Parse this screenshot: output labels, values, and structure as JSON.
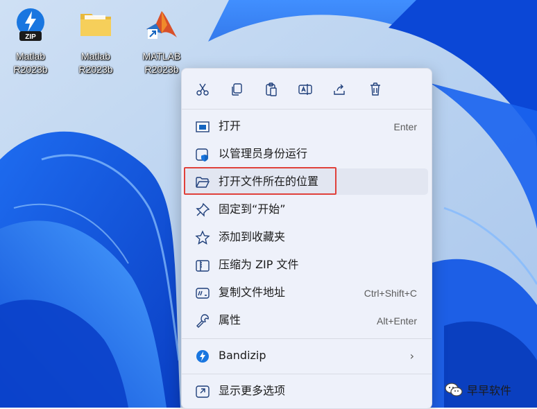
{
  "desktop": {
    "icons": [
      {
        "label_line1": "Matlab",
        "label_line2": "R2023b",
        "icon": "zip-archive-icon"
      },
      {
        "label_line1": "Matlab",
        "label_line2": "R2023b",
        "icon": "folder-icon"
      },
      {
        "label_line1": "MATLAB",
        "label_line2": "R2023b",
        "icon": "matlab-shortcut-icon"
      }
    ]
  },
  "context_menu": {
    "quick_actions": [
      {
        "name": "cut",
        "icon": "scissors-icon"
      },
      {
        "name": "copy",
        "icon": "copy-icon"
      },
      {
        "name": "paste",
        "icon": "paste-icon"
      },
      {
        "name": "rename",
        "icon": "rename-icon"
      },
      {
        "name": "share",
        "icon": "share-icon"
      },
      {
        "name": "delete",
        "icon": "trash-icon"
      }
    ],
    "items": [
      {
        "label": "打开",
        "shortcut": "Enter",
        "icon": "open-window-icon"
      },
      {
        "label": "以管理员身份运行",
        "shortcut": "",
        "icon": "admin-shield-icon"
      },
      {
        "label": "打开文件所在的位置",
        "shortcut": "",
        "icon": "folder-open-icon",
        "highlighted": true
      },
      {
        "label": "固定到“开始”",
        "shortcut": "",
        "icon": "pin-icon"
      },
      {
        "label": "添加到收藏夹",
        "shortcut": "",
        "icon": "star-icon"
      },
      {
        "label": "压缩为 ZIP 文件",
        "shortcut": "",
        "icon": "zip-folder-icon"
      },
      {
        "label": "复制文件地址",
        "shortcut": "Ctrl+Shift+C",
        "icon": "copy-path-icon"
      },
      {
        "label": "属性",
        "shortcut": "Alt+Enter",
        "icon": "wrench-icon"
      },
      {
        "label": "Bandizip",
        "shortcut": "",
        "icon": "bandizip-icon",
        "submenu": true
      },
      {
        "label": "显示更多选项",
        "shortcut": "",
        "icon": "more-options-icon"
      }
    ]
  },
  "watermark": {
    "text": "早早软件",
    "icon": "wechat-icon"
  },
  "colors": {
    "highlight_border": "#e0403a",
    "accent": "#0f6cbd",
    "menu_bg": "#eef1fa"
  }
}
